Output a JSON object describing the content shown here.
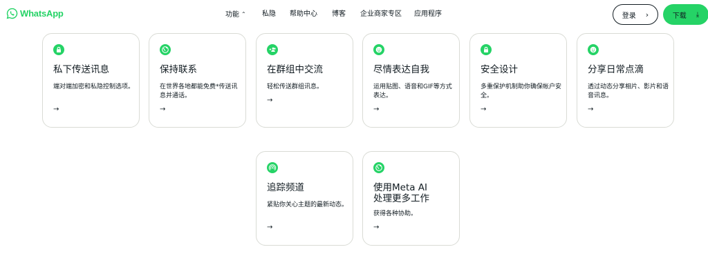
{
  "brand": {
    "name": "WhatsApp",
    "color": "#25d366"
  },
  "nav": {
    "items": [
      {
        "label": "功能",
        "has_chevron": true
      },
      {
        "label": "私隐"
      },
      {
        "label": "帮助中心"
      },
      {
        "label": "博客"
      },
      {
        "label": "企业商家专区"
      },
      {
        "label": "应用程序"
      }
    ]
  },
  "header_buttons": {
    "login_label": "登录",
    "download_label": "下载"
  },
  "cards": [
    {
      "icon": "lock-icon",
      "title": "私下传送讯息",
      "description": "端对端加密和私隐控制选项。"
    },
    {
      "icon": "globe-icon",
      "title": "保持联系",
      "description": "在世界各地都能免费*传送讯息并通话。"
    },
    {
      "icon": "group-add-icon",
      "title": "在群组中交流",
      "description": "轻松传送群组讯息。"
    },
    {
      "icon": "smiley-icon",
      "title": "尽情表达自我",
      "description": "运用贴图、语音和GIF等方式表达。"
    },
    {
      "icon": "lock-icon",
      "title": "安全设计",
      "description": "多重保护机制助你确保帐户安全。"
    },
    {
      "icon": "smiley-icon",
      "title": "分享日常点滴",
      "description": "透过动态分享相片、影片和语音讯息。"
    },
    {
      "icon": "channel-icon",
      "title": "追踪频道",
      "description": "紧贴你关心主题的最新动态。"
    },
    {
      "icon": "globe-icon",
      "title": "使用Meta AI\n处理更多工作",
      "description": "获得各种协助。"
    }
  ],
  "arrow_glyph": "→"
}
